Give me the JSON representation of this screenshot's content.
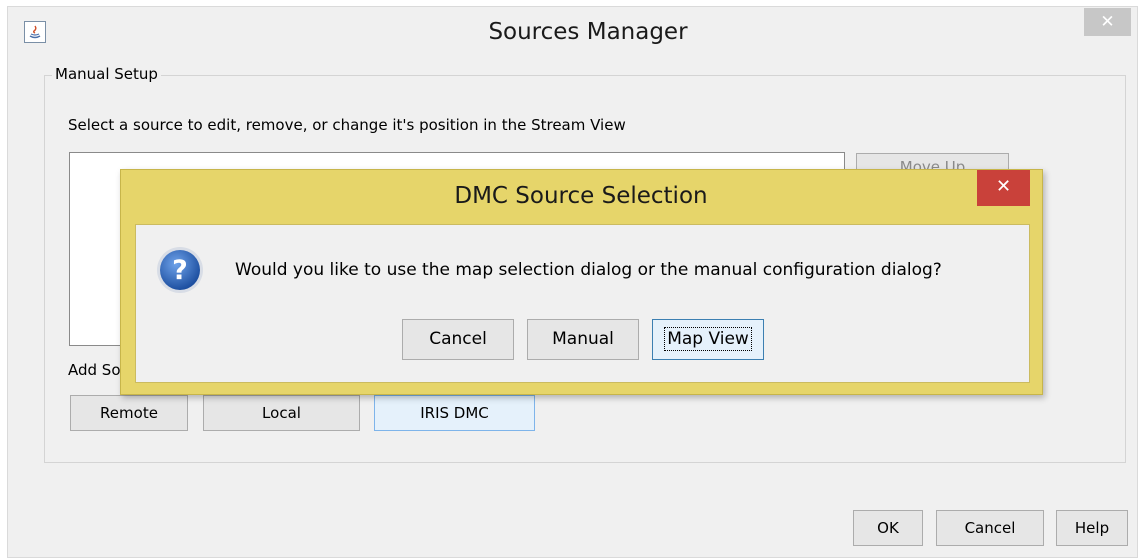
{
  "main_window": {
    "title": "Sources Manager",
    "close_glyph": "✕",
    "app_icon": "java-icon"
  },
  "manual_setup": {
    "group_label": "Manual Setup",
    "instruction": "Select a source to edit, remove, or change it's position in the Stream View",
    "move_up_label": "Move Up",
    "add_label": "Add Sources",
    "remote_label": "Remote",
    "local_label": "Local",
    "iris_label": "IRIS DMC"
  },
  "footer": {
    "ok_label": "OK",
    "cancel_label": "Cancel",
    "help_label": "Help"
  },
  "dialog": {
    "title": "DMC Source Selection",
    "close_glyph": "✕",
    "icon": "question-icon",
    "message": "Would you like to use the map selection dialog or the manual configuration dialog?",
    "cancel_label": "Cancel",
    "manual_label": "Manual",
    "map_view_label": "Map View"
  },
  "colors": {
    "dialog_frame": "#e6d56a",
    "dialog_close": "#c9413a",
    "window_bg": "#f0f0f0",
    "focus_button": "#e5f1fb"
  }
}
